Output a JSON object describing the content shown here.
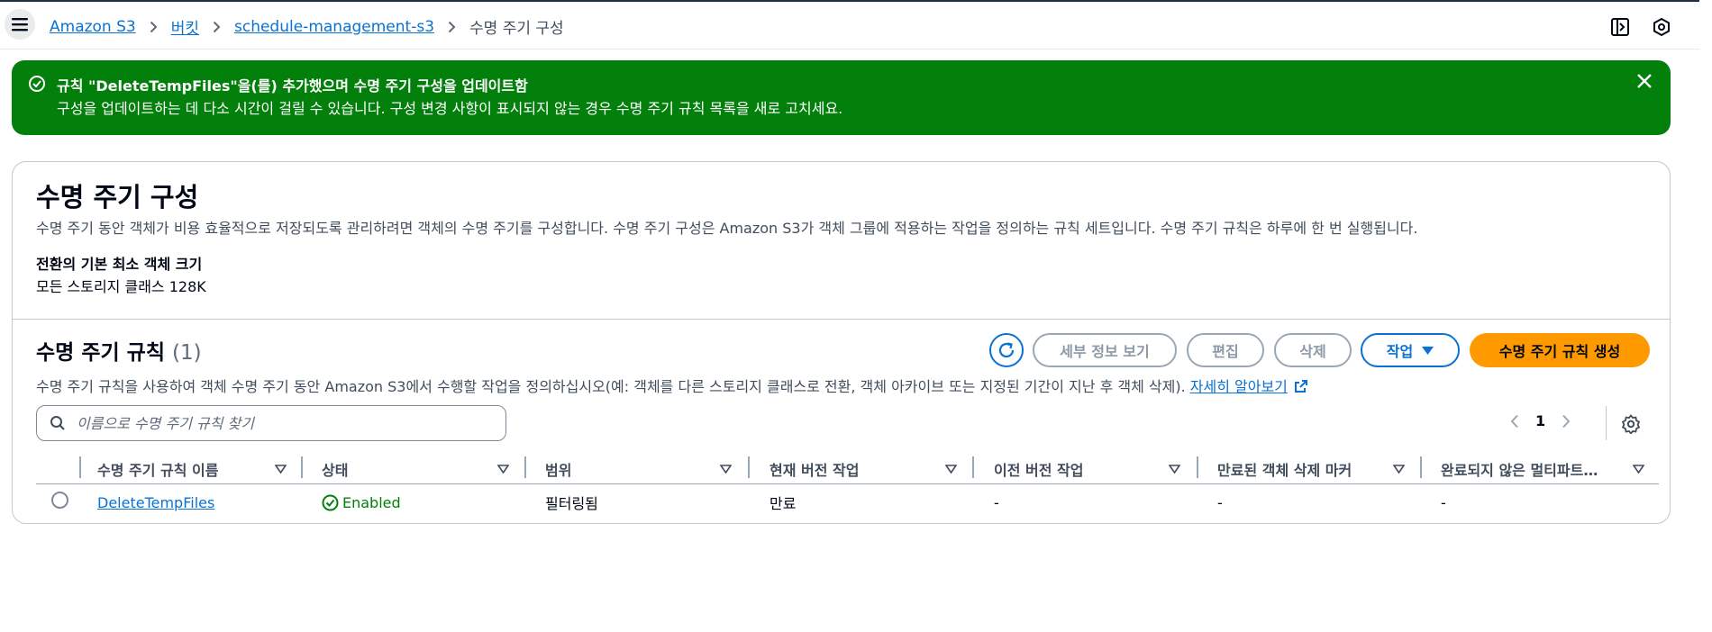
{
  "breadcrumb": {
    "items": [
      "Amazon S3",
      "버킷",
      "schedule-management-s3"
    ],
    "current": "수명 주기 구성"
  },
  "icons": {
    "menu": "menu-icon",
    "panel": "side-panel-icon",
    "notifications": "hexagon-icon",
    "success": "check-circle-icon",
    "close": "close-icon",
    "refresh": "refresh-icon",
    "external": "external-link-icon",
    "search": "search-icon",
    "settings": "gear-icon"
  },
  "flash": {
    "title": "규칙 \"DeleteTempFiles\"을(를) 추가했으며 수명 주기 구성을 업데이트함",
    "body": "구성을 업데이트하는 데 다소 시간이 걸릴 수 있습니다. 구성 변경 사항이 표시되지 않는 경우 수명 주기 규칙 목록을 새로 고치세요.",
    "color": "#037f0c"
  },
  "config": {
    "title": "수명 주기 구성",
    "description": "수명 주기 동안 객체가 비용 효율적으로 저장되도록 관리하려면 객체의 수명 주기를 구성합니다. 수명 주기 구성은 Amazon S3가 객체 그룹에 적용하는 작업을 정의하는 규칙 세트입니다. 수명 주기 규칙은 하루에 한 번 실행됩니다.",
    "min_size_label": "전환의 기본 최소 객체 크기",
    "min_size_value": "모든 스토리지 클래스 128K"
  },
  "rules": {
    "title": "수명 주기 규칙",
    "count": "(1)",
    "buttons": {
      "details": "세부 정보 보기",
      "edit": "편집",
      "delete": "삭제",
      "actions": "작업",
      "create": "수명 주기 규칙 생성"
    },
    "description": "수명 주기 규칙을 사용하여 객체 수명 주기 동안 Amazon S3에서 수행할 작업을 정의하십시오(예: 객체를 다른 스토리지 클래스로 전환, 객체 아카이브 또는 지정된 기간이 지난 후 객체 삭제).",
    "learn_more": "자세히 알아보기",
    "search_placeholder": "이름으로 수명 주기 규칙 찾기",
    "page": "1",
    "columns": [
      "수명 주기 규칙 이름",
      "상태",
      "범위",
      "현재 버전 작업",
      "이전 버전 작업",
      "만료된 객체 삭제 마커",
      "완료되지 않은 멀티파트…"
    ],
    "rows": [
      {
        "name": "DeleteTempFiles",
        "status": "Enabled",
        "scope": "필터링됨",
        "current_action": "만료",
        "previous_action": "-",
        "expired_marker": "-",
        "incomplete_multipart": "-"
      }
    ]
  },
  "colors": {
    "link": "#0972d3",
    "primary_button": "#ff9900",
    "success": "#037f0c"
  }
}
